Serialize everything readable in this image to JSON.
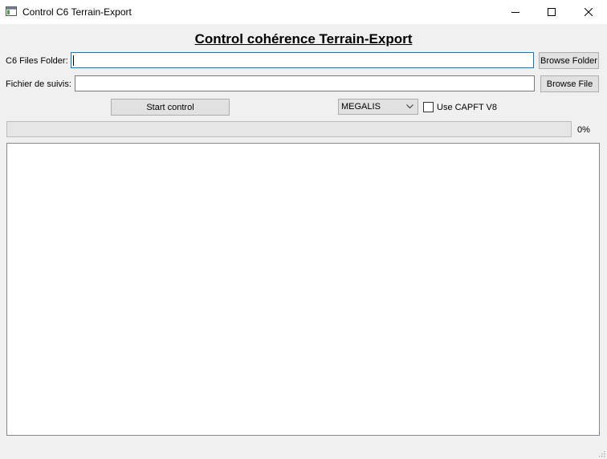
{
  "window": {
    "title": "Control C6 Terrain-Export",
    "controls": {
      "minimize": "minimize-icon",
      "maximize": "maximize-icon",
      "close": "close-icon"
    }
  },
  "header": {
    "title": "Control cohérence Terrain-Export"
  },
  "form": {
    "c6_folder": {
      "label": "C6 Files Folder:",
      "value": "",
      "browse_label": "Browse Folder"
    },
    "tracking_file": {
      "label": "Fichier de suivis:",
      "value": "",
      "browse_label": "Browse File"
    },
    "start_label": "Start control",
    "profile": {
      "selected": "MEGALIS"
    },
    "capft": {
      "label": "Use CAPFT V8",
      "checked": false
    }
  },
  "progress": {
    "value": 0,
    "text": "0%"
  },
  "log": {
    "text": ""
  },
  "colors": {
    "focus_border": "#0078d7",
    "button_bg": "#e1e1e1",
    "window_bg": "#f0f0f0"
  }
}
